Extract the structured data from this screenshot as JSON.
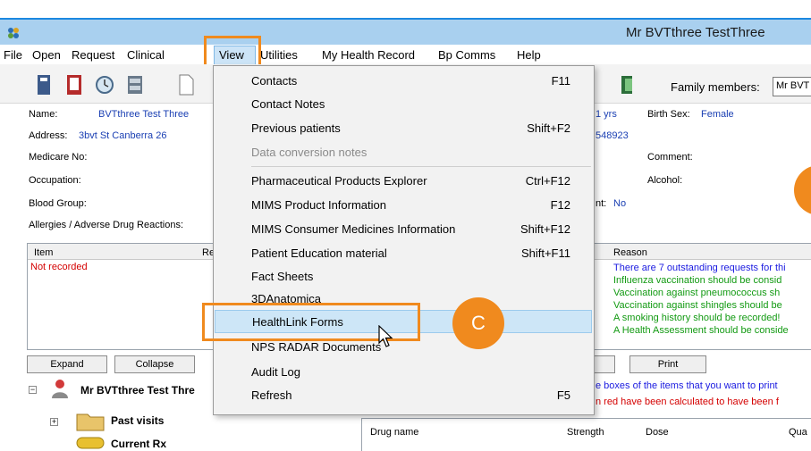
{
  "window": {
    "title": "Mr BVTthree TestThree"
  },
  "menu": [
    "File",
    "Open",
    "Request",
    "Clinical",
    "View",
    "Utilities",
    "My Health Record",
    "Bp Comms",
    "Help"
  ],
  "toolbar": {
    "family_members_label": "Family members:",
    "family_members_value": "Mr BVT"
  },
  "patient": {
    "name_label": "Name:",
    "name_value": "BVTthree Test Three",
    "address_label": "Address:",
    "address_value": "3bvt St Canberra 26",
    "medicare_label": "Medicare No:",
    "occupation_label": "Occupation:",
    "blood_label": "Blood Group:",
    "allergies_label": "Allergies / Adverse Drug Reactions:",
    "age_fragment": "1 yrs",
    "phone_fragment": "548923",
    "birth_sex_label": "Birth Sex:",
    "birth_sex_value": "Female",
    "comment_label": "Comment:",
    "alcohol_label": "Alcohol:",
    "nt_fragment": "nt:",
    "nt_value": "No"
  },
  "allergies": {
    "col_item": "Item",
    "col_re": "Re",
    "row_value": "Not recorded"
  },
  "reminders": {
    "col_reason": "Reason",
    "rows": [
      "There are 7 outstanding requests for thi",
      "Influenza vaccination should be consid",
      "Vaccination against pneumococcus sh",
      "Vaccination against shingles should be",
      "A smoking history should be recorded!",
      "A Health Assessment should be conside"
    ],
    "button_fragment": "e",
    "print_label": "Print",
    "note1": "e boxes of the items that you want to print",
    "note2": "n red have been calculated to have been f"
  },
  "buttons": {
    "expand": "Expand",
    "collapse": "Collapse"
  },
  "tree": {
    "patient": "Mr BVTthree Test Thre",
    "past_visits": "Past visits",
    "current_rx": "Current Rx"
  },
  "drugs": {
    "col_name": "Drug name",
    "col_strength": "Strength",
    "col_dose": "Dose",
    "col_qua": "Qua"
  },
  "view_menu": [
    {
      "label": "Contacts",
      "shortcut": "F11"
    },
    {
      "label": "Contact Notes",
      "shortcut": ""
    },
    {
      "label": "Previous patients",
      "shortcut": "Shift+F2"
    },
    {
      "label": "Data conversion notes",
      "shortcut": ""
    },
    {
      "label": "Pharmaceutical Products Explorer",
      "shortcut": "Ctrl+F12"
    },
    {
      "label": "MIMS Product Information",
      "shortcut": "F12"
    },
    {
      "label": "MIMS Consumer Medicines Information",
      "shortcut": "Shift+F12"
    },
    {
      "label": "Patient Education material",
      "shortcut": "Shift+F11"
    },
    {
      "label": "Fact Sheets",
      "shortcut": ""
    },
    {
      "label": "3DAnatomica",
      "shortcut": ""
    },
    {
      "label": "HealthLink Forms",
      "shortcut": ""
    },
    {
      "label": "NPS RADAR Documents",
      "shortcut": ""
    },
    {
      "label": "Audit Log",
      "shortcut": ""
    },
    {
      "label": "Refresh",
      "shortcut": "F5"
    }
  ],
  "callout": {
    "letter": "C"
  },
  "colors": {
    "accent_orange": "#f08a1e",
    "title_bar": "#a9d0ef",
    "highlight": "#cde6f7"
  }
}
